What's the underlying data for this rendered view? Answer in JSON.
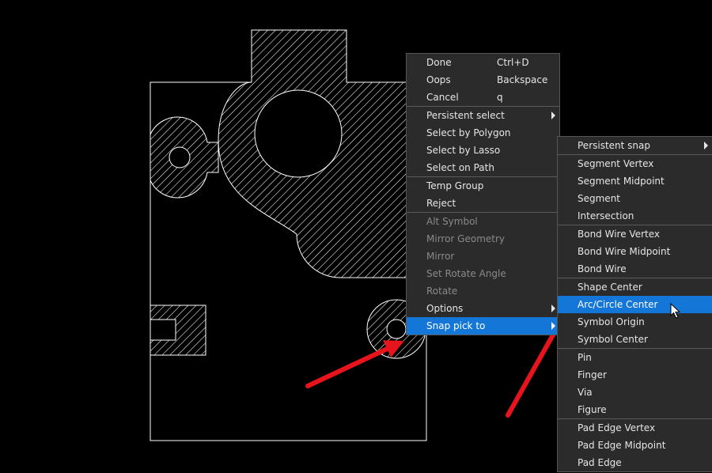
{
  "colors": {
    "background": "#000000",
    "geometry": "#ffffff",
    "menu_bg": "#2b2b2b",
    "menu_text": "#e6e6e6",
    "menu_disabled": "#8a8a8a",
    "highlight": "#1476d6",
    "annotation_arrow": "#e8141c"
  },
  "context_menu": {
    "groups": [
      [
        {
          "label": "Done",
          "shortcut": "Ctrl+D"
        },
        {
          "label": "Oops",
          "shortcut": "Backspace"
        },
        {
          "label": "Cancel",
          "shortcut": "q"
        }
      ],
      [
        {
          "label": "Persistent select",
          "submenu": true
        },
        {
          "label": "Select by Polygon"
        },
        {
          "label": "Select by Lasso"
        },
        {
          "label": "Select on Path"
        }
      ],
      [
        {
          "label": "Temp Group"
        },
        {
          "label": "Reject"
        }
      ],
      [
        {
          "label": "Alt Symbol",
          "disabled": true
        },
        {
          "label": "Mirror Geometry",
          "disabled": true
        },
        {
          "label": "Mirror",
          "disabled": true
        },
        {
          "label": "Set Rotate Angle",
          "disabled": true
        },
        {
          "label": "Rotate",
          "disabled": true
        },
        {
          "label": "Options",
          "submenu": true
        },
        {
          "label": "Snap pick to",
          "submenu": true,
          "selected": true
        }
      ]
    ]
  },
  "snap_submenu": {
    "groups": [
      [
        {
          "label": "Persistent snap",
          "submenu": true
        }
      ],
      [
        {
          "label": "Segment Vertex"
        },
        {
          "label": "Segment Midpoint"
        },
        {
          "label": "Segment"
        },
        {
          "label": "Intersection"
        }
      ],
      [
        {
          "label": "Bond Wire Vertex"
        },
        {
          "label": "Bond Wire Midpoint"
        },
        {
          "label": "Bond Wire"
        }
      ],
      [
        {
          "label": "Shape Center"
        },
        {
          "label": "Arc/Circle Center",
          "selected": true
        },
        {
          "label": "Symbol Origin"
        },
        {
          "label": "Symbol Center"
        }
      ],
      [
        {
          "label": "Pin"
        },
        {
          "label": "Finger"
        },
        {
          "label": "Via"
        },
        {
          "label": "Figure"
        }
      ],
      [
        {
          "label": "Pad Edge Vertex"
        },
        {
          "label": "Pad Edge Midpoint"
        },
        {
          "label": "Pad Edge"
        }
      ]
    ]
  },
  "icons": {
    "cursor": "mouse-pointer-icon",
    "submenu": "chevron-right-icon",
    "annotation": "red-arrow-icon"
  }
}
